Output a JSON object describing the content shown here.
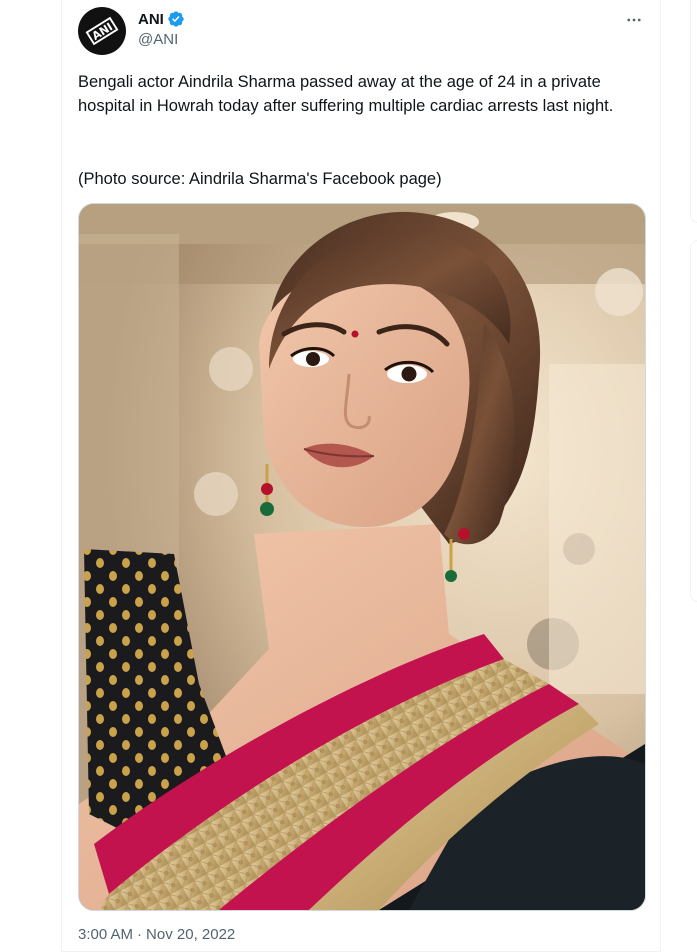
{
  "author": {
    "display_name": "ANI",
    "handle": "@ANI",
    "avatar_text": "ANI",
    "verified_icon": "verified-badge-icon",
    "verified_color": "#1d9bf0"
  },
  "tweet": {
    "text": "Bengali actor Aindrila Sharma passed away at the age of 24 in a private hospital in Howrah today after suffering multiple cardiac arrests last night.",
    "source": "(Photo source: Aindrila Sharma's Facebook page)",
    "time": "3:00 AM",
    "separator": "·",
    "date": "Nov 20, 2022"
  },
  "icons": {
    "more": "more-horizontal-icon"
  },
  "colors": {
    "text_primary": "#0f1419",
    "text_secondary": "#536471",
    "border": "#eff3f4"
  }
}
